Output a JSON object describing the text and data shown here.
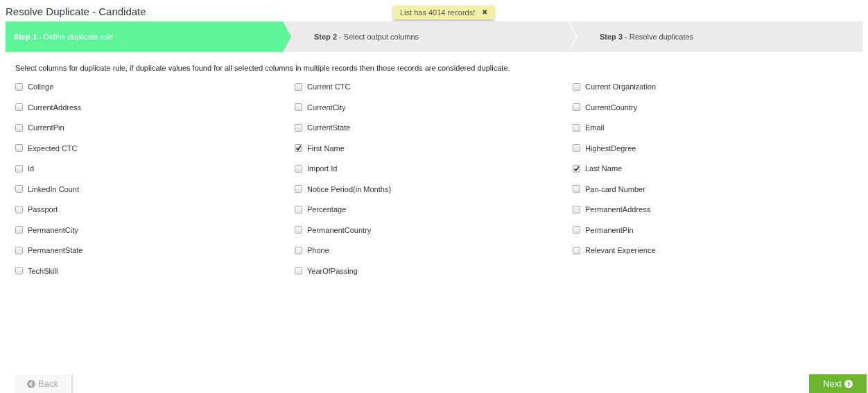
{
  "title": "Resolve Duplicate - Candidate",
  "toast": {
    "text": "List has 4014 records!",
    "close": "✖"
  },
  "steps": [
    {
      "label": "**Step 1** - Define duplicate rule",
      "selected": true
    },
    {
      "label": "**Step 2** - Select output columns",
      "selected": false
    },
    {
      "label": "**Step 3** - Resolve duplicates",
      "selected": false
    }
  ],
  "instruction": "Select columns for duplicate rule, if duplicate values found for all selected columns in multiple records then those records are considered duplicate.",
  "columns": [
    {
      "label": "College",
      "checked": false
    },
    {
      "label": "Current CTC",
      "checked": false
    },
    {
      "label": "Current Organization",
      "checked": false
    },
    {
      "label": "CurrentAddress",
      "checked": false
    },
    {
      "label": "CurrentCity",
      "checked": false
    },
    {
      "label": "CurrentCountry",
      "checked": false
    },
    {
      "label": "CurrentPin",
      "checked": false
    },
    {
      "label": "CurrentState",
      "checked": false
    },
    {
      "label": "Email",
      "checked": false
    },
    {
      "label": "Expected CTC",
      "checked": false
    },
    {
      "label": "First Name",
      "checked": true
    },
    {
      "label": "HighestDegree",
      "checked": false
    },
    {
      "label": "Id",
      "checked": false
    },
    {
      "label": "Import Id",
      "checked": false
    },
    {
      "label": "Last Name",
      "checked": true
    },
    {
      "label": "LinkedIn Count",
      "checked": false
    },
    {
      "label": "Notice Period(in Months)",
      "checked": false
    },
    {
      "label": "Pan-card Number",
      "checked": false
    },
    {
      "label": "Passport",
      "checked": false
    },
    {
      "label": "Percentage",
      "checked": false
    },
    {
      "label": "PermanentAddress",
      "checked": false
    },
    {
      "label": "PermanentCity",
      "checked": false
    },
    {
      "label": "PermanentCountry",
      "checked": false
    },
    {
      "label": "PermanentPin",
      "checked": false
    },
    {
      "label": "PermanentState",
      "checked": false
    },
    {
      "label": "Phone",
      "checked": false
    },
    {
      "label": "Relevant Experience",
      "checked": false
    },
    {
      "label": "TechSkill",
      "checked": false
    },
    {
      "label": "YearOfPassing",
      "checked": false
    }
  ],
  "back_button": {
    "label": "Back",
    "disabled": true
  },
  "next_button": {
    "label": "Next"
  }
}
